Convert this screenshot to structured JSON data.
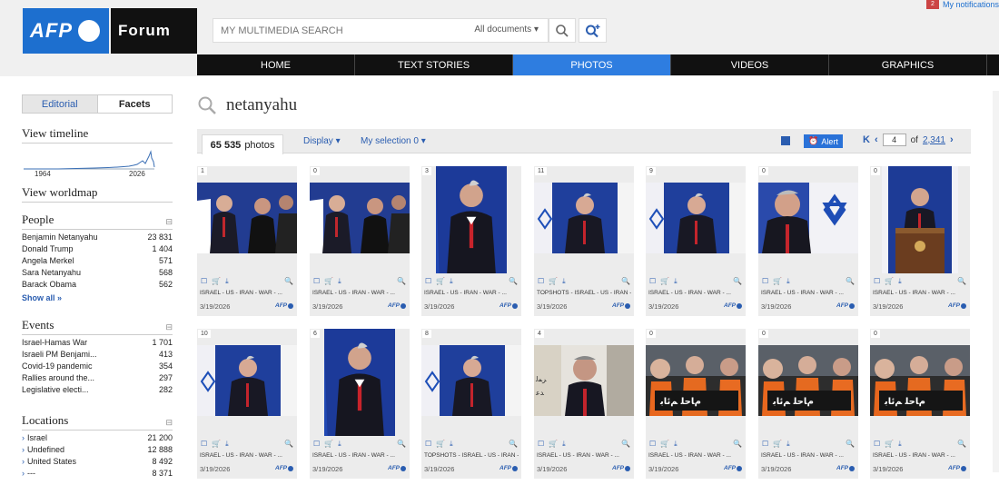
{
  "header": {
    "logo_afp": "AFP",
    "logo_forum": "Forum",
    "search_placeholder": "MY MULTIMEDIA SEARCH",
    "search_scope": "All documents",
    "notifications_label": "My notifications",
    "notifications_count": "2"
  },
  "nav": [
    "HOME",
    "TEXT STORIES",
    "PHOTOS",
    "VIDEOS",
    "GRAPHICS"
  ],
  "active_nav": "PHOTOS",
  "sidebar": {
    "tabs": [
      "Editorial",
      "Facets"
    ],
    "active_tab": "Facets",
    "timeline": {
      "title": "View timeline",
      "start": "1964",
      "end": "2026"
    },
    "worldmap_title": "View worldmap",
    "people": {
      "title": "People",
      "items": [
        {
          "label": "Benjamin Netanyahu",
          "count": "23 831"
        },
        {
          "label": "Donald Trump",
          "count": "1 404"
        },
        {
          "label": "Angela Merkel",
          "count": "571"
        },
        {
          "label": "Sara Netanyahu",
          "count": "568"
        },
        {
          "label": "Barack Obama",
          "count": "562"
        }
      ],
      "show_all": "Show all »"
    },
    "events": {
      "title": "Events",
      "items": [
        {
          "label": "Israel-Hamas War",
          "count": "1 701"
        },
        {
          "label": "Israeli PM Benjami...",
          "count": "413"
        },
        {
          "label": "Covid-19 pandemic",
          "count": "354"
        },
        {
          "label": "Rallies around the...",
          "count": "297"
        },
        {
          "label": "Legislative electi...",
          "count": "282"
        }
      ]
    },
    "locations": {
      "title": "Locations",
      "items": [
        {
          "label": "Israel",
          "count": "21 200"
        },
        {
          "label": "Undefined",
          "count": "12 888"
        },
        {
          "label": "United States",
          "count": "8 492"
        },
        {
          "label": "---",
          "count": "8 371"
        }
      ]
    }
  },
  "main": {
    "query": "netanyahu",
    "count_value": "65 535",
    "count_unit": "photos",
    "display_label": "Display",
    "selection_label": "My selection 0",
    "alert_label": "Alert",
    "page_current": "4",
    "page_of": "of",
    "page_total": "2,341"
  },
  "photos": [
    {
      "badge": "1",
      "caption": "ISRAEL - US - IRAN - WAR - ...",
      "date": "3/19/2026",
      "scene": "two-men"
    },
    {
      "badge": "0",
      "caption": "ISRAEL - US - IRAN - WAR - ...",
      "date": "3/19/2026",
      "scene": "two-men"
    },
    {
      "badge": "3",
      "caption": "ISRAEL - US - IRAN - WAR - ...",
      "date": "3/19/2026",
      "scene": "portrait-blue"
    },
    {
      "badge": "11",
      "caption": "TOPSHOTS - ISRAEL - US - IRAN -",
      "date": "3/19/2026",
      "scene": "podium-blue"
    },
    {
      "badge": "9",
      "caption": "ISRAEL - US - IRAN - WAR - ...",
      "date": "3/19/2026",
      "scene": "podium-blue"
    },
    {
      "badge": "0",
      "caption": "ISRAEL - US - IRAN - WAR - ...",
      "date": "3/19/2026",
      "scene": "closeup-flag"
    },
    {
      "badge": "0",
      "caption": "ISRAEL - US - IRAN - WAR - ...",
      "date": "3/19/2026",
      "scene": "lectern"
    },
    {
      "badge": "10",
      "caption": "ISRAEL - US - IRAN - WAR - ...",
      "date": "3/19/2026",
      "scene": "podium-blue"
    },
    {
      "badge": "6",
      "caption": "ISRAEL - US - IRAN - WAR - ...",
      "date": "3/19/2026",
      "scene": "portrait-blue"
    },
    {
      "badge": "8",
      "caption": "TOPSHOTS - ISRAEL - US - IRAN -",
      "date": "3/19/2026",
      "scene": "podium-blue"
    },
    {
      "badge": "4",
      "caption": "ISRAEL - US - IRAN - WAR - ...",
      "date": "3/19/2026",
      "scene": "mural"
    },
    {
      "badge": "0",
      "caption": "ISRAEL - US - IRAN - WAR - ...",
      "date": "3/19/2026",
      "scene": "protest"
    },
    {
      "badge": "0",
      "caption": "ISRAEL - US - IRAN - WAR - ...",
      "date": "3/19/2026",
      "scene": "protest"
    },
    {
      "badge": "0",
      "caption": "ISRAEL - US - IRAN - WAR - ...",
      "date": "3/19/2026",
      "scene": "protest"
    }
  ],
  "photo_credit": "AFP",
  "colors": {
    "accent": "#2e7de0",
    "link": "#2a5db0",
    "logo_blue": "#1d6fcf"
  }
}
